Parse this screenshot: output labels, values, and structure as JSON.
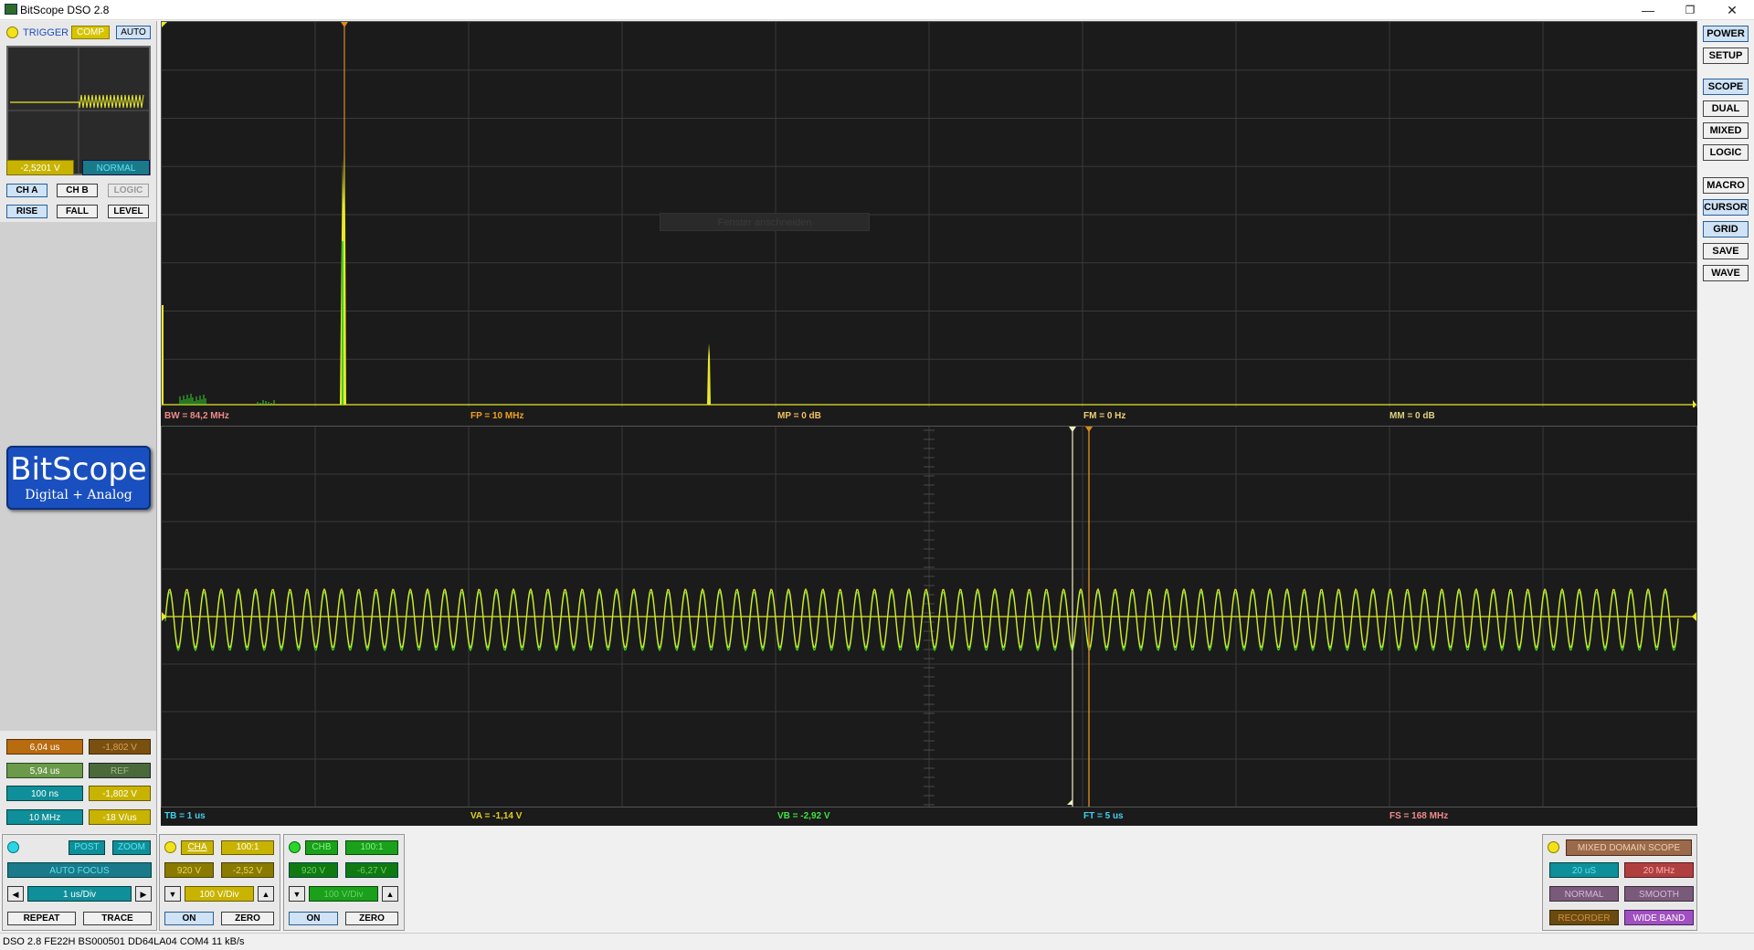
{
  "window": {
    "title": "BitScope DSO 2.8",
    "minimize": "—",
    "restore": "❐",
    "close": "✕"
  },
  "trigger": {
    "label": "TRIGGER",
    "comp": "COMP",
    "auto": "AUTO",
    "voltage": "-2,5201 V",
    "mode": "NORMAL",
    "source_buttons": [
      "CH A",
      "CH B",
      "LOGIC"
    ],
    "edge_buttons": [
      "RISE",
      "FALL",
      "LEVEL"
    ]
  },
  "logo": {
    "name": "BitScope",
    "tagline": "Digital + Analog"
  },
  "measure": {
    "rows": [
      [
        "6,04 us",
        "-1,802 V"
      ],
      [
        "5,94 us",
        "REF"
      ],
      [
        "100 ns",
        "-1,802 V"
      ],
      [
        "10 MHz",
        "-18 V/us"
      ]
    ]
  },
  "spectrum": {
    "tooltip": "Fenster anschneiden",
    "info": {
      "bw": "BW = 84,2 MHz",
      "fp": "FP = 10 MHz",
      "mp": "MP = 0 dB",
      "fm": "FM = 0 Hz",
      "mm": "MM = 0 dB"
    }
  },
  "time": {
    "info": {
      "tb": "TB = 1 us",
      "va": "VA = -1,14 V",
      "vb": "VB = -2,92 V",
      "ft": "FT = 5 us",
      "fs": "FS = 168 MHz"
    },
    "cycles": 88
  },
  "right_buttons": {
    "power": "POWER",
    "setup": "SETUP",
    "scope": "SCOPE",
    "dual": "DUAL",
    "mixed": "MIXED",
    "logic": "LOGIC",
    "macro": "MACRO",
    "cursor": "CURSOR",
    "grid": "GRID",
    "save": "SAVE",
    "wave": "WAVE"
  },
  "timebase_panel": {
    "post": "POST",
    "zoom": "ZOOM",
    "autofocus": "AUTO FOCUS",
    "timebase": "1 us/Div",
    "left_arrow": "◀",
    "right_arrow": "▶",
    "repeat": "REPEAT",
    "trace": "TRACE"
  },
  "channel_a": {
    "name": "CHA",
    "probe": "100:1",
    "range": "920 V",
    "offset": "-2,52 V",
    "scale": "100 V/Div",
    "down": "▼",
    "up": "▲",
    "on": "ON",
    "zero": "ZERO"
  },
  "channel_b": {
    "name": "CHB",
    "probe": "100:1",
    "range": "920 V",
    "offset": "-6,27 V",
    "scale": "100 V/Div",
    "down": "▼",
    "up": "▲",
    "on": "ON",
    "zero": "ZERO"
  },
  "mixed_panel": {
    "title": "MIXED DOMAIN SCOPE",
    "duration": "20 uS",
    "rate": "20 MHz",
    "normal": "NORMAL",
    "smooth": "SMOOTH",
    "recorder": "RECORDER",
    "wideband": "WIDE BAND"
  },
  "status": "DSO 2.8 FE22H BS000501 DD64LA04 COM4 11 kB/s",
  "colors": {
    "trace_yellow": "#e8e82a",
    "trace_green": "#39d12a",
    "cursor_orange": "#d98a1e",
    "background": "#1b1b1b",
    "grid": "#3a3a3a"
  }
}
